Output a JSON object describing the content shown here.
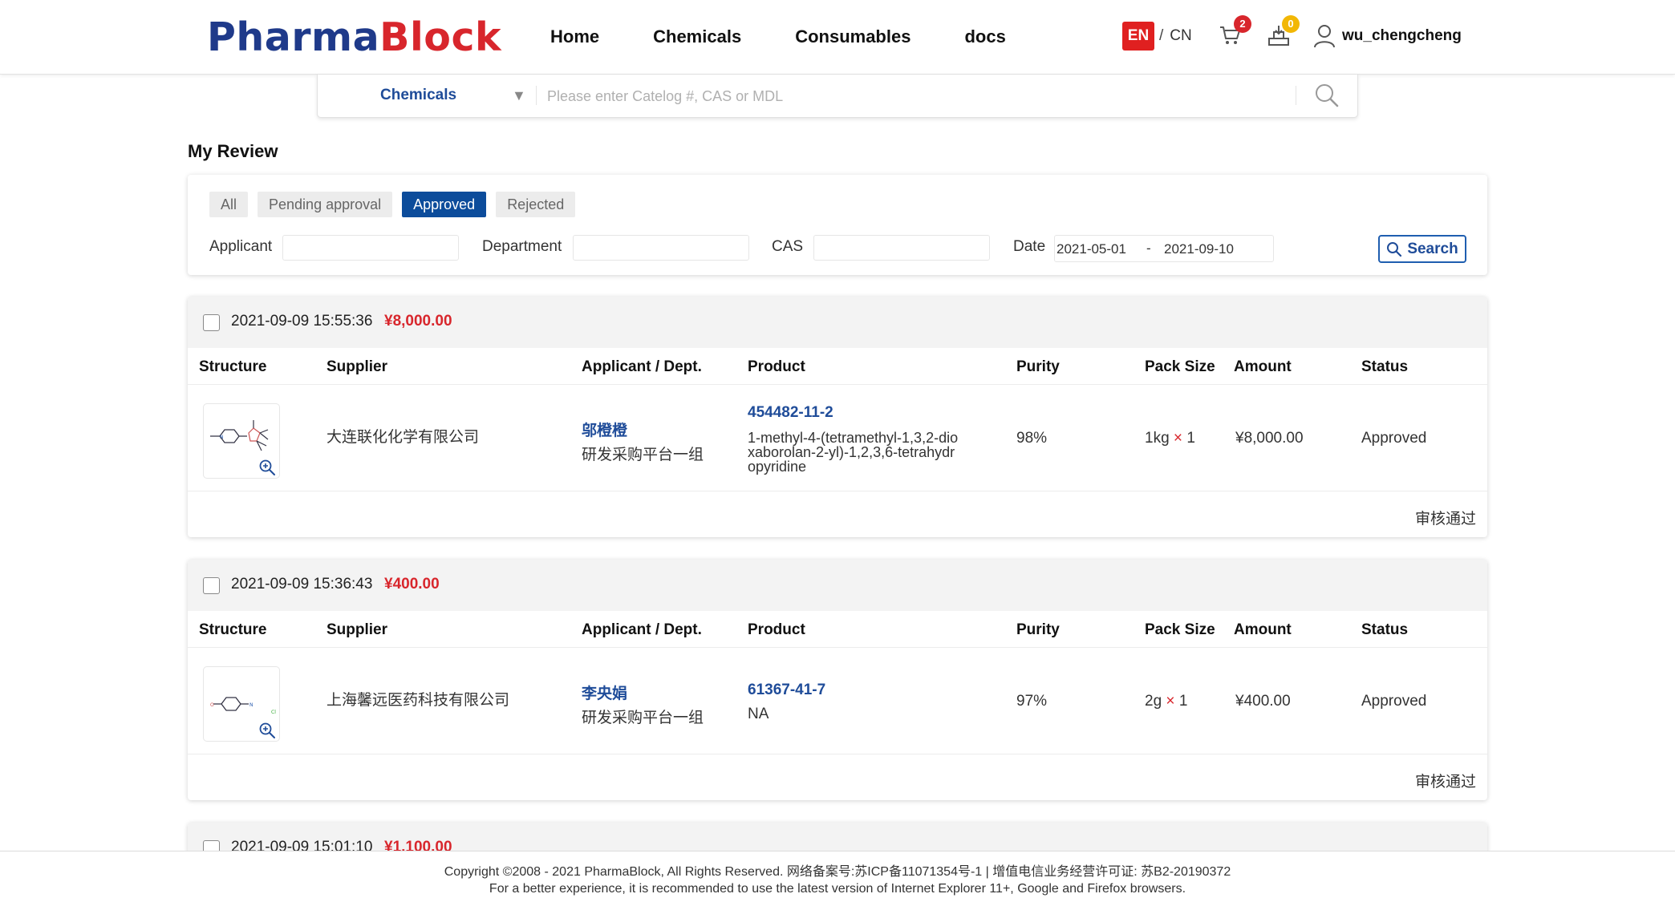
{
  "brand": {
    "part1": "Pharma",
    "part2": "Block"
  },
  "nav": [
    "Home",
    "Chemicals",
    "Consumables",
    "docs"
  ],
  "lang": {
    "active": "EN",
    "separator": "/",
    "other": "CN"
  },
  "cart": {
    "count": "2",
    "icon": "cart-icon"
  },
  "orders": {
    "count": "0",
    "icon": "orders-icon"
  },
  "user": {
    "name": "wu_chengcheng",
    "icon": "user-icon"
  },
  "search": {
    "category": "Chemicals",
    "placeholder": "Please enter Catelog #, CAS or MDL",
    "value": ""
  },
  "page_title": "My Review",
  "filter": {
    "tabs": [
      "All",
      "Pending approval",
      "Approved",
      "Rejected"
    ],
    "active_tab": "Approved",
    "applicant_label": "Applicant",
    "applicant_value": "",
    "department_label": "Department",
    "department_value": "",
    "cas_label": "CAS",
    "cas_value": "",
    "date_label": "Date",
    "date_from": "2021-05-01",
    "date_sep": "-",
    "date_to": "2021-09-10",
    "search_button": "Search"
  },
  "columns": {
    "structure": "Structure",
    "supplier": "Supplier",
    "applicant": "Applicant / Dept.",
    "product": "Product",
    "purity": "Purity",
    "pack_size": "Pack Size",
    "amount": "Amount",
    "status": "Status"
  },
  "orders_list": [
    {
      "time": "2021-09-09 15:55:36",
      "total": "¥8,000.00",
      "supplier": "大连联化化学有限公司",
      "applicant": "邬橙橙",
      "department": "研发采购平台一组",
      "cas": "454482-11-2",
      "product_name": "1-methyl-4-(tetramethyl-1,3,2-dioxaborolan-2-yl)-1,2,3,6-tetrahydropyridine",
      "purity": "98%",
      "pack": "1kg",
      "times": "×",
      "qty": "1",
      "amount": "¥8,000.00",
      "status": "Approved",
      "review": "审核通过"
    },
    {
      "time": "2021-09-09 15:36:43",
      "total": "¥400.00",
      "supplier": "上海馨远医药科技有限公司",
      "applicant": "李央娟",
      "department": "研发采购平台一组",
      "cas": "61367-41-7",
      "product_name": "NA",
      "purity": "97%",
      "pack": "2g",
      "times": "×",
      "qty": "1",
      "amount": "¥400.00",
      "status": "Approved",
      "review": "审核通过"
    },
    {
      "time": "2021-09-09 15:01:10",
      "total": "¥1,100.00"
    }
  ],
  "footer": {
    "line1": "Copyright ©2008 - 2021 PharmaBlock, All Rights Reserved. 网络备案号:苏ICP备11071354号-1 | 增值电信业务经营许可证: 苏B2-20190372",
    "line2": "For a better experience, it is recommended to use the latest version of Internet Explorer 11+, Google and Firefox browsers."
  },
  "colors": {
    "brand_blue": "#1f3a8a",
    "brand_red": "#d8262c",
    "accent_blue": "#0c4c9b",
    "price_red": "#d8262c",
    "badge_yellow": "#f2b705"
  }
}
